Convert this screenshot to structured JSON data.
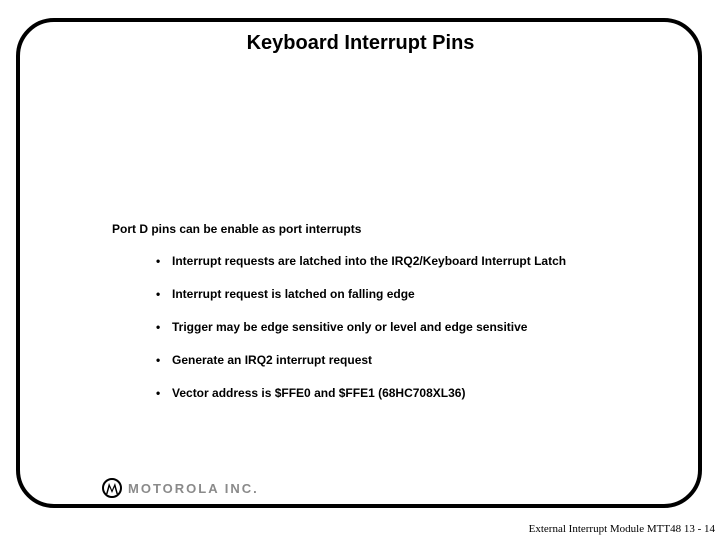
{
  "title": "Keyboard Interrupt Pins",
  "heading": "Port D pins can be enable as port interrupts",
  "bullets": [
    "Interrupt requests are latched into the IRQ2/Keyboard Interrupt Latch",
    "Interrupt request is latched on falling edge",
    "Trigger may be edge sensitive only or level and edge sensitive",
    "Generate an IRQ2 interrupt request",
    "Vector address is $FFE0 and $FFE1  (68HC708XL36)"
  ],
  "logo_text": "MOTOROLA INC.",
  "footer": "External Interrupt Module MTT48 13 - 14"
}
